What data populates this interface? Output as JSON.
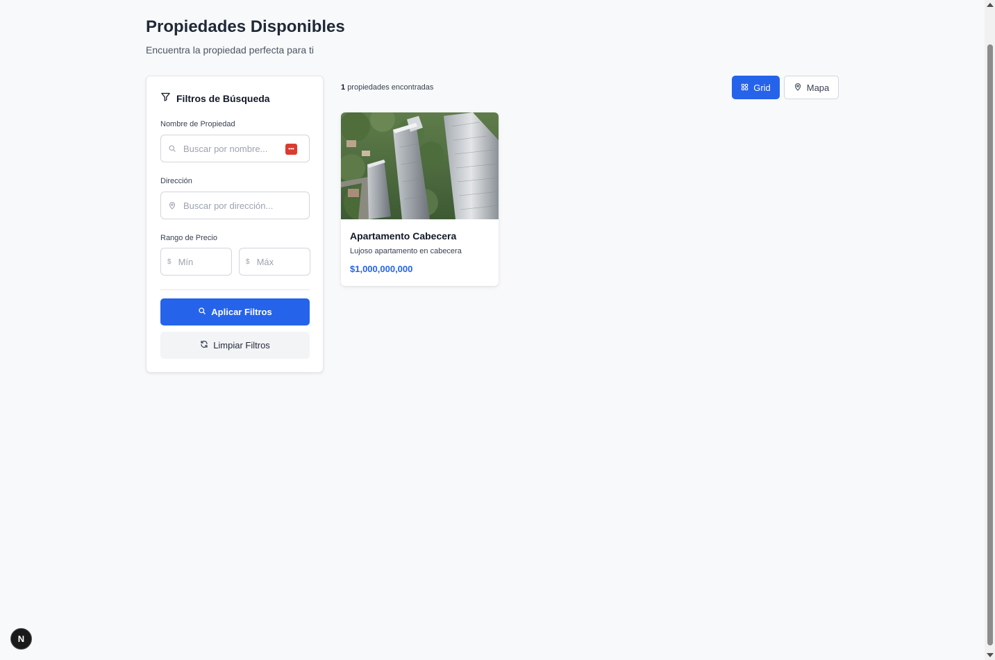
{
  "header": {
    "title": "Propiedades Disponibles",
    "subtitle": "Encuentra la propiedad perfecta para ti"
  },
  "filters": {
    "title": "Filtros de Búsqueda",
    "name": {
      "label": "Nombre de Propiedad",
      "placeholder": "Buscar por nombre...",
      "value": ""
    },
    "address": {
      "label": "Dirección",
      "placeholder": "Buscar por dirección...",
      "value": ""
    },
    "price": {
      "label": "Rango de Precio",
      "currency": "$",
      "min_placeholder": "Mín",
      "max_placeholder": "Máx"
    },
    "apply_label": "Aplicar Filtros",
    "clear_label": "Limpiar Filtros"
  },
  "results": {
    "count": "1",
    "count_text": "propiedades encontradas"
  },
  "view_toggle": {
    "grid_label": "Grid",
    "map_label": "Mapa",
    "active": "Grid"
  },
  "properties": [
    {
      "title": "Apartamento Cabecera",
      "description": "Lujoso apartamento en cabecera",
      "price": "$1,000,000,000"
    }
  ],
  "dev_badge": {
    "letter": "N"
  },
  "colors": {
    "accent": "#2563eb",
    "background": "#f8f9fb",
    "password_manager_badge": "#dc3b2f"
  }
}
